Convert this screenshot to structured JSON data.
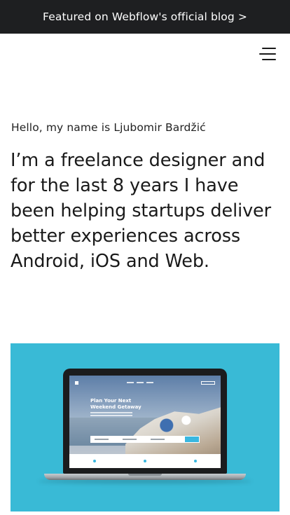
{
  "banner": {
    "text": "Featured on Webflow's official blog >"
  },
  "header": {
    "menu_icon": "hamburger-menu-icon"
  },
  "hero": {
    "greeting": "Hello, my name is Ljubomir Bardžić",
    "intro": "I’m a freelance designer and for the last 8 years I have been helping startups deliver better experiences across Android, iOS and Web."
  },
  "showcase": {
    "background": "#39bad6",
    "screen_headline": "Plan Your Next Weekend Getaway"
  },
  "colors": {
    "banner_bg": "#1e1f21",
    "text": "#1a1a1a",
    "accent": "#39bad6"
  }
}
